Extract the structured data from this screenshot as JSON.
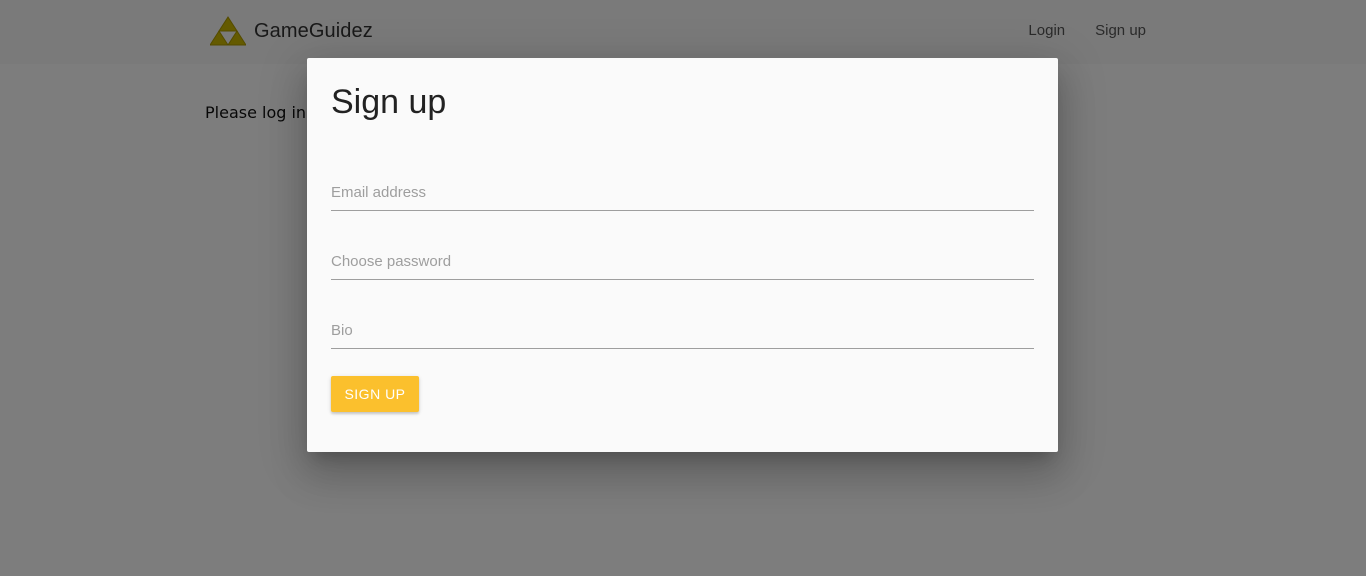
{
  "navbar": {
    "brand": "GameGuidez",
    "links": [
      "Login",
      "Sign up"
    ]
  },
  "main": {
    "message": "Please log in"
  },
  "modal": {
    "title": "Sign up",
    "fields": {
      "email_placeholder": "Email address",
      "password_placeholder": "Choose password",
      "bio_placeholder": "Bio"
    },
    "submit_label": "SIGN UP"
  },
  "colors": {
    "accent": "#fbc02d",
    "logo": "#c8b400",
    "overlay": "rgba(0,0,0,0.5)"
  },
  "icons": {
    "logo": "triforce-icon"
  }
}
